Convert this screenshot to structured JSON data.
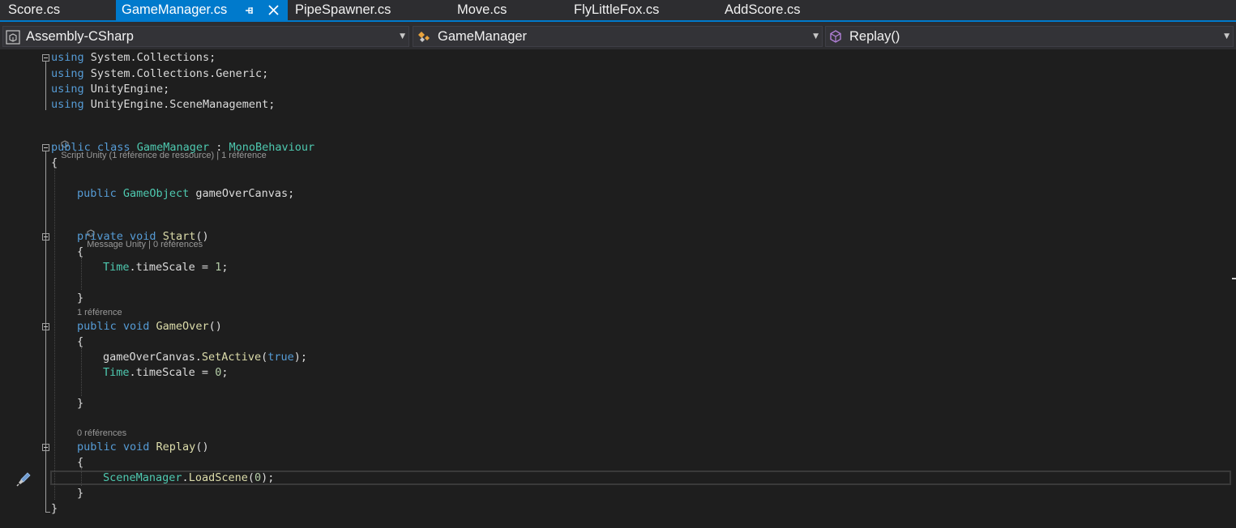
{
  "tabs": [
    {
      "label": "Score.cs",
      "active": false
    },
    {
      "label": "GameManager.cs",
      "active": true,
      "pin_icon": "⊣",
      "close_icon": "✕"
    },
    {
      "label": "PipeSpawner.cs",
      "active": false
    },
    {
      "label": "Move.cs",
      "active": false
    },
    {
      "label": "FlyLittleFox.cs",
      "active": false
    },
    {
      "label": "AddScore.cs",
      "active": false
    }
  ],
  "navbar": {
    "project": "Assembly-CSharp",
    "type": "GameManager",
    "member": "Replay()"
  },
  "code": {
    "l1": {
      "kw": "using",
      "rest": " System.Collections;"
    },
    "l2": {
      "kw": "using",
      "rest": " System.Collections.Generic;"
    },
    "l3": {
      "kw": "using",
      "rest": " UnityEngine;"
    },
    "l4": {
      "kw": "using",
      "rest": " UnityEngine.SceneManagement;"
    },
    "lens_class": "Script Unity (1 référence de ressource) | 1 référence",
    "class_decl": {
      "kw": "public class",
      "name": "GameManager",
      "sep": " : ",
      "base": "MonoBehaviour"
    },
    "brace_open": "{",
    "field": {
      "kw": "public",
      "type": "GameObject",
      "rest": " gameOverCanvas;"
    },
    "lens_start": "Message Unity | 0 références",
    "start_decl": {
      "kw": "private void",
      "name": "Start",
      "rest": "()"
    },
    "start_open": "{",
    "start_body": {
      "type": "Time",
      "rest": ".timeScale = ",
      "num": "1",
      "end": ";"
    },
    "start_close": "}",
    "lens_gameover": "1 référence",
    "gameover_decl": {
      "kw": "public void",
      "name": "GameOver",
      "rest": "()"
    },
    "gameover_open": "{",
    "gameover_body1": {
      "obj": "gameOverCanvas.",
      "fn": "SetActive",
      "p1": "(",
      "kw": "true",
      "p2": ");"
    },
    "gameover_body2": {
      "type": "Time",
      "rest": ".timeScale = ",
      "num": "0",
      "end": ";"
    },
    "gameover_close": "}",
    "lens_replay": "0 références",
    "replay_decl": {
      "kw": "public void",
      "name": "Replay",
      "rest": "()"
    },
    "replay_open": "{",
    "replay_body": {
      "type": "SceneManager",
      "dot": ".",
      "fn": "LoadScene",
      "p1": "(",
      "num": "0",
      "p2": ");"
    },
    "replay_close": "}",
    "brace_close": "}"
  },
  "icons": {
    "project_icon": "csharp-project-icon",
    "type_icon": "class-icon",
    "member_icon": "method-cube-icon",
    "edit_icon": "pencil-brush-icon",
    "dropdown_icon": "chevron-down-icon"
  },
  "colors": {
    "accent": "#007acc",
    "keyword": "#569cd6",
    "type": "#4ec9b0",
    "function": "#dcdcaa",
    "number": "#b5cea8",
    "text": "#dcdcdc",
    "background": "#1e1e1e"
  }
}
